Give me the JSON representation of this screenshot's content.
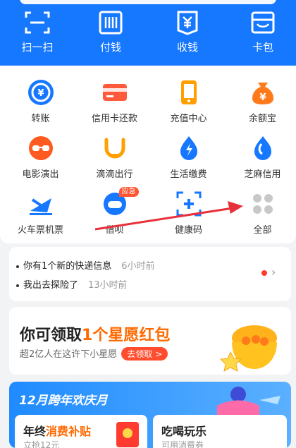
{
  "top_actions": [
    {
      "label": "扫一扫",
      "icon": "scan-icon"
    },
    {
      "label": "付钱",
      "icon": "barcode-pay-icon"
    },
    {
      "label": "收钱",
      "icon": "receive-money-icon"
    },
    {
      "label": "卡包",
      "icon": "card-wallet-icon"
    }
  ],
  "grid": [
    {
      "label": "转账",
      "icon": "transfer-icon"
    },
    {
      "label": "信用卡还款",
      "icon": "credit-card-icon"
    },
    {
      "label": "充值中心",
      "icon": "phone-recharge-icon"
    },
    {
      "label": "余额宝",
      "icon": "yuebao-icon"
    },
    {
      "label": "电影演出",
      "icon": "movie-icon"
    },
    {
      "label": "滴滴出行",
      "icon": "didi-icon"
    },
    {
      "label": "生活缴费",
      "icon": "utility-bill-icon"
    },
    {
      "label": "芝麻信用",
      "icon": "sesame-credit-icon"
    },
    {
      "label": "火车票机票",
      "icon": "train-plane-icon"
    },
    {
      "label": "借呗",
      "icon": "jiebei-icon",
      "badge": "应急"
    },
    {
      "label": "健康码",
      "icon": "health-code-icon"
    },
    {
      "label": "全部",
      "icon": "all-apps-icon"
    }
  ],
  "notice": {
    "items": [
      {
        "text": "你有1个新的快递信息",
        "time": "6小时前"
      },
      {
        "text": "我出去探险了",
        "time": "13小时前"
      }
    ]
  },
  "promo": {
    "title_pre": "你可领取",
    "title_hl": "1个星愿红包",
    "subtitle": "超2亿人在这许下小星愿",
    "button": "去领取 >"
  },
  "event": {
    "title": "12月跨年欢庆月",
    "cards": [
      {
        "title_pre": "年终",
        "title_hl": "消费补贴",
        "sub": "立抢12元"
      },
      {
        "title_pre": "吃喝玩乐",
        "title_hl": "",
        "sub": "可用消费券"
      }
    ]
  },
  "colors": {
    "brand_blue": "#1677ff",
    "accent_orange": "#ff6a00",
    "annotation_arrow": "#e8303a"
  }
}
